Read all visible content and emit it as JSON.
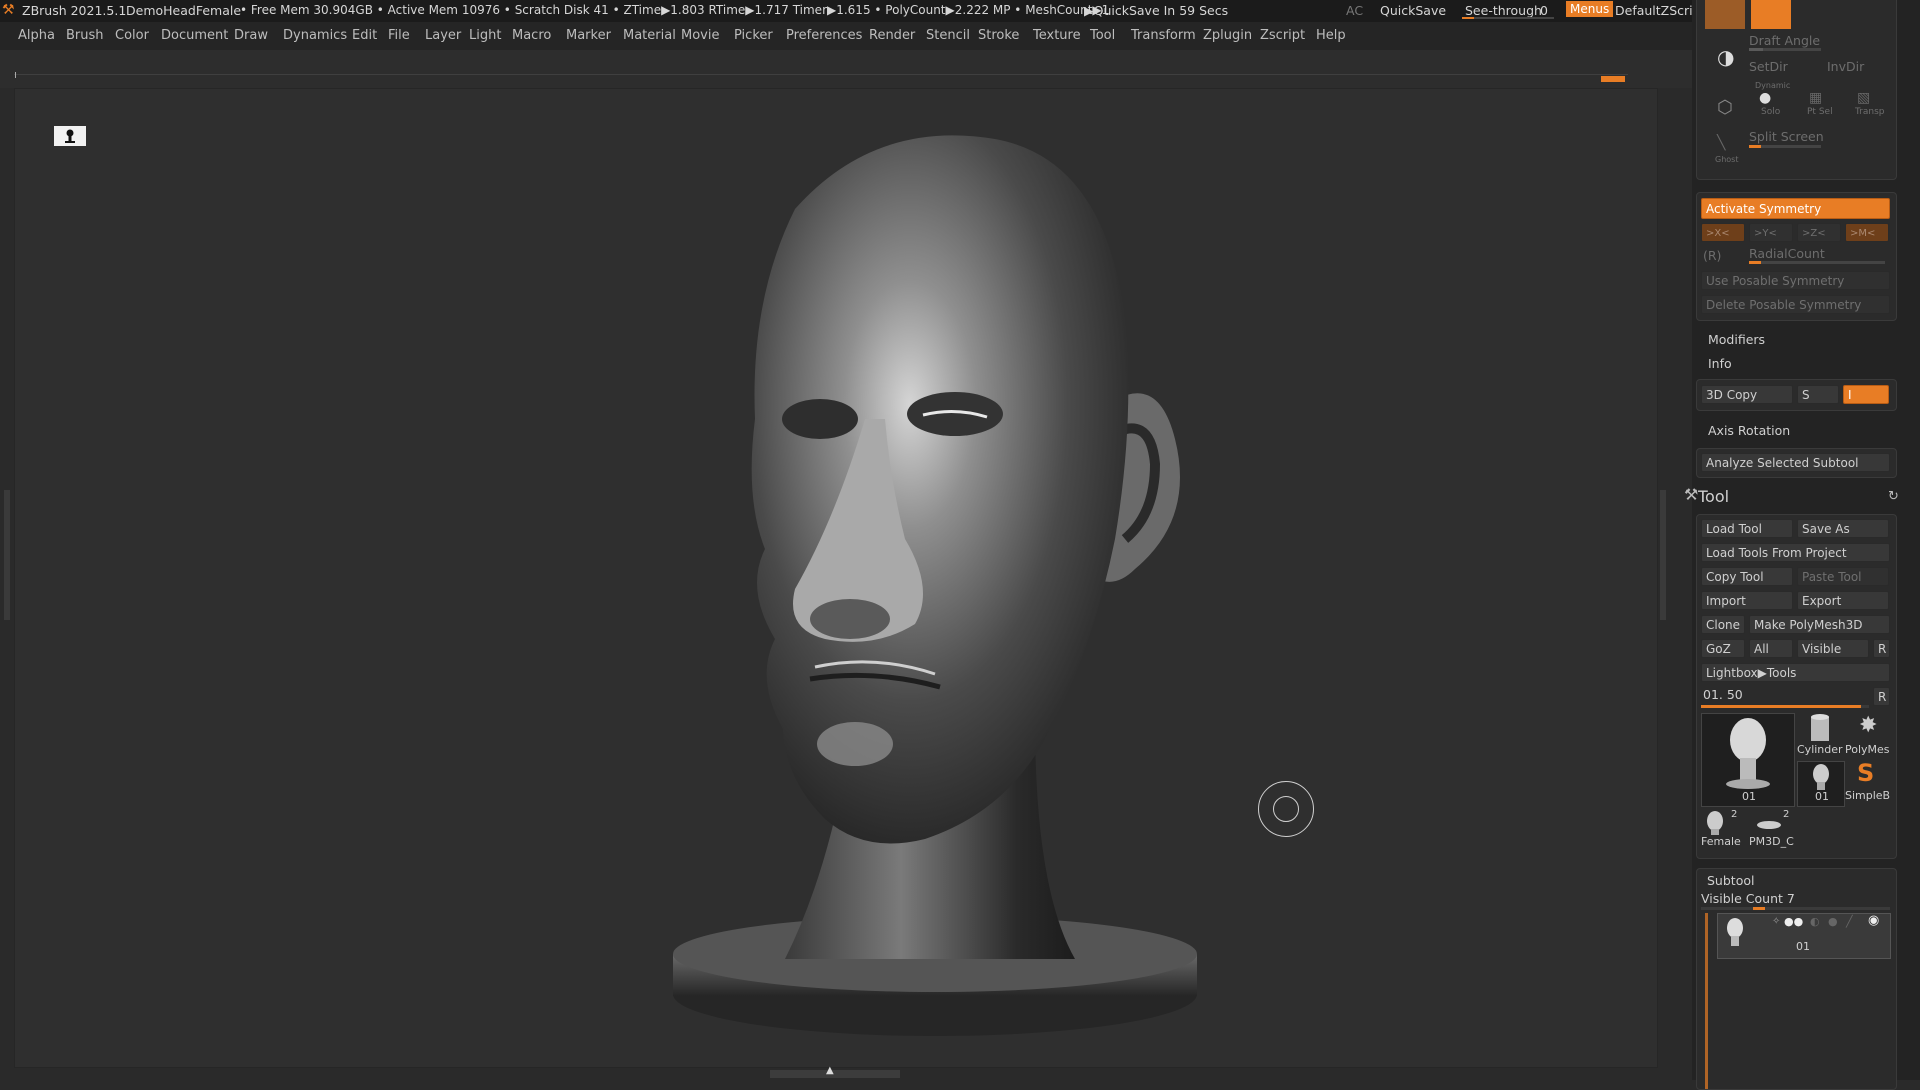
{
  "titlebar": {
    "app": "ZBrush 2021.5.1",
    "document": "DemoHeadFemale",
    "status": "• Free Mem 30.904GB • Active Mem 10976 • Scratch Disk 41 •  ZTime▶1.803 RTime▶1.717 Timer▶1.615 • PolyCount▶2.222 MP • MeshCount▶1",
    "quicksave_timer": "▶QuickSave In 59 Secs",
    "ac": "AC",
    "quicksave": "QuickSave",
    "seethrough": "See-through",
    "seethrough_value": "0",
    "menus": "Menus",
    "zscript": "DefaultZScript"
  },
  "menus": [
    "Alpha",
    "Brush",
    "Color",
    "Document",
    "Draw",
    "Dynamics",
    "Edit",
    "File",
    "Layer",
    "Light",
    "Macro",
    "Marker",
    "Material",
    "Movie",
    "Picker",
    "Preferences",
    "Render",
    "Stencil",
    "Stroke",
    "Texture",
    "Tool",
    "Transform",
    "Zplugin",
    "Zscript",
    "Help"
  ],
  "panel": {
    "draft_angle": "Draft Angle",
    "setdir": "SetDir",
    "invdir": "InvDir",
    "dynamic": "Dynamic",
    "solo": "Solo",
    "ptsel": "Pt Sel",
    "transp": "Transp",
    "ghost": "Ghost",
    "split_screen": "Split Screen",
    "activate_symmetry": "Activate Symmetry",
    "axes": [
      ">X<",
      ">Y<",
      ">Z<",
      ">M<"
    ],
    "r_label": "(R)",
    "radial_count": "RadialCount",
    "use_posable": "Use Posable Symmetry",
    "delete_posable": "Delete Posable Symmetry",
    "modifiers": "Modifiers",
    "info": "Info",
    "copy3d": "3D Copy",
    "s": "S",
    "copy_value": "I",
    "axis_rotation": "Axis Rotation",
    "analyze": "Analyze Selected Subtool"
  },
  "tool": {
    "title": "Tool",
    "load_tool": "Load Tool",
    "save_as": "Save As",
    "load_project": "Load Tools From Project",
    "copy_tool": "Copy Tool",
    "paste_tool": "Paste Tool",
    "import": "Import",
    "export": "Export",
    "clone": "Clone",
    "make_polymesh": "Make PolyMesh3D",
    "goz": "GoZ",
    "all": "All",
    "visible": "Visible",
    "r": "R",
    "lightbox": "Lightbox▶Tools",
    "slider_label": "01. 50",
    "slider_value": 0.95,
    "thumbs": {
      "main": "01",
      "cylinder": "Cylinder",
      "polymesh": "PolyMes",
      "small01": "01",
      "simpleb": "SimpleB",
      "female": "Female",
      "female_count": "2",
      "pm3d": "PM3D_C",
      "pm3d_count": "2"
    }
  },
  "subtool": {
    "title": "Subtool",
    "visible_count": "Visible Count 7",
    "item": "01"
  },
  "colors": {
    "accent": "#e87d25",
    "panel": "#232323",
    "viewport": "#2f2f2f"
  }
}
